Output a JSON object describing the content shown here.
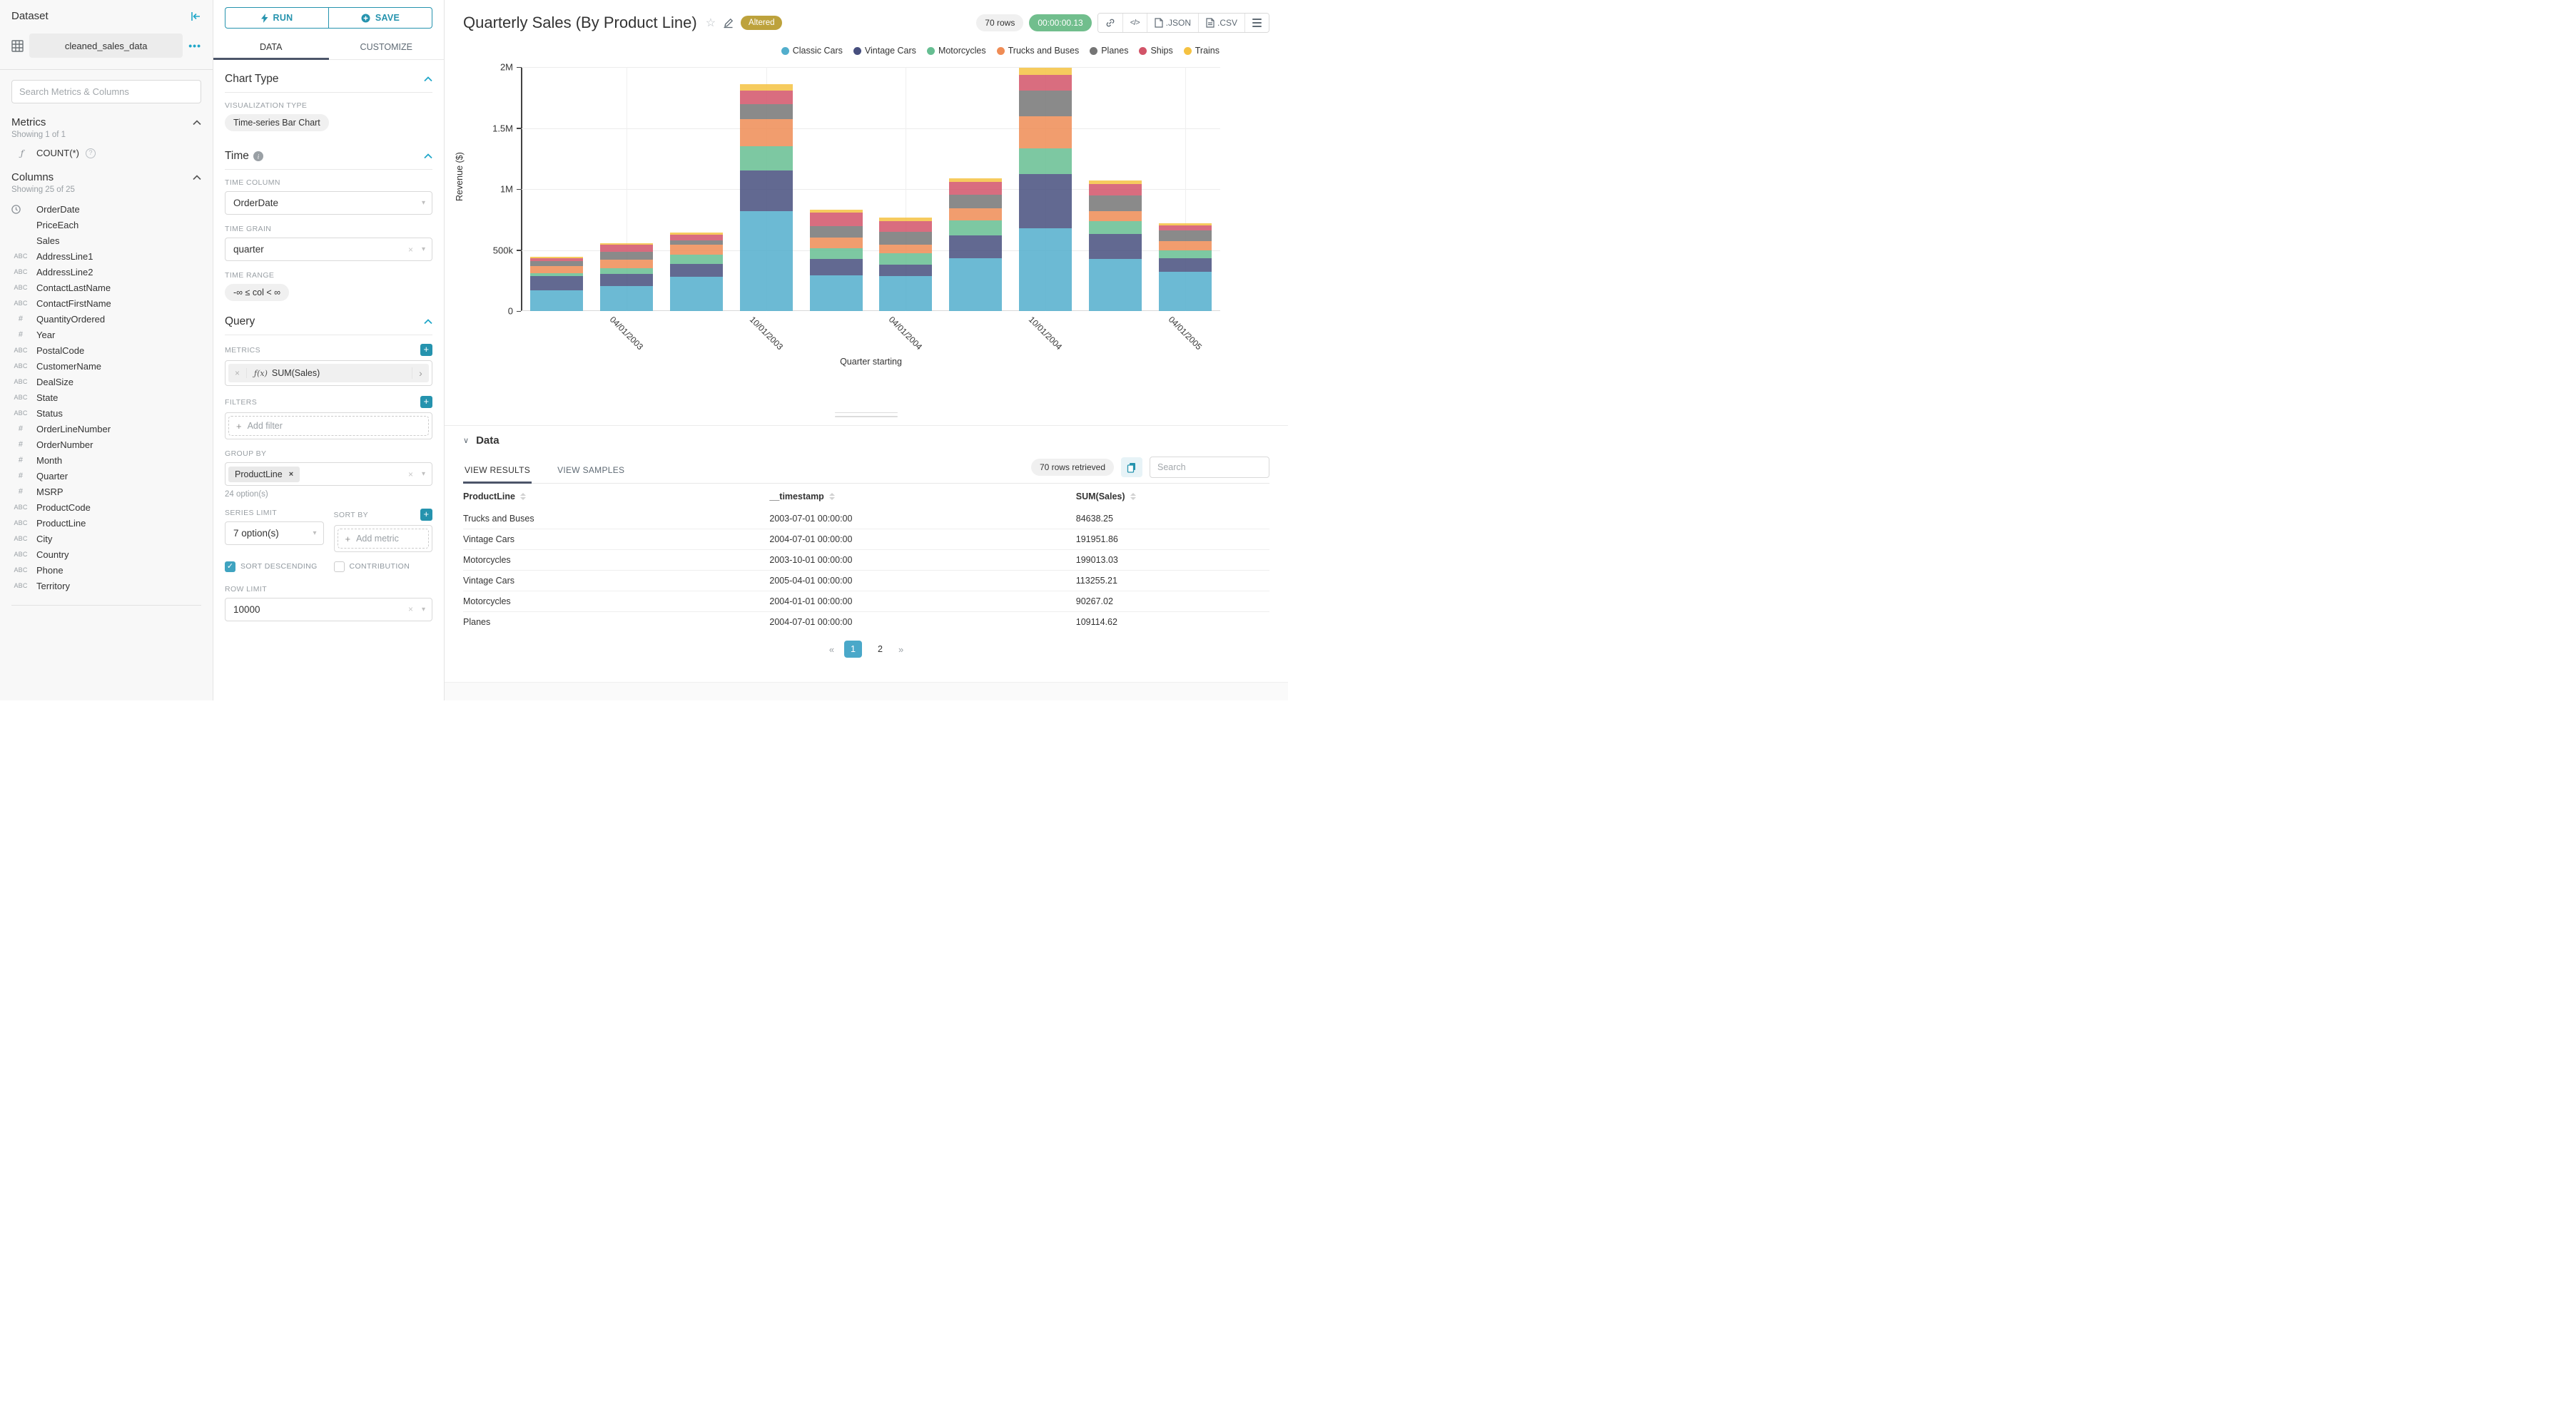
{
  "colors": {
    "accent_teal": "#2593ae",
    "light_teal": "#20a7c9",
    "tab_underline": "#4c5569",
    "altered_badge": "#bda23c",
    "timer_green": "#71be8d",
    "pagination_active": "#4aa8c9"
  },
  "glyphs": {
    "ellipsis": "•••",
    "close": "×",
    "chevron_right": "›",
    "fx": "ƒ(x)",
    "f": "ƒ",
    "plus": "+",
    "prev": "«",
    "next": "»",
    "code": "</>",
    "star": "☆",
    "help": "?",
    "check": "✓",
    "caret": "▾",
    "chev_down": "∨"
  },
  "sidebar": {
    "title": "Dataset",
    "dataset_name": "cleaned_sales_data",
    "search_placeholder": "Search Metrics & Columns",
    "metrics": {
      "title": "Metrics",
      "showing": "Showing 1 of 1",
      "items": [
        {
          "name": "COUNT(*)"
        }
      ]
    },
    "columns": {
      "title": "Columns",
      "showing": "Showing 25 of 25",
      "items": [
        {
          "type": "time",
          "name": "OrderDate"
        },
        {
          "type": "none",
          "name": "PriceEach"
        },
        {
          "type": "none",
          "name": "Sales"
        },
        {
          "type": "text",
          "name": "AddressLine1"
        },
        {
          "type": "text",
          "name": "AddressLine2"
        },
        {
          "type": "text",
          "name": "ContactLastName"
        },
        {
          "type": "text",
          "name": "ContactFirstName"
        },
        {
          "type": "num",
          "name": "QuantityOrdered"
        },
        {
          "type": "num",
          "name": "Year"
        },
        {
          "type": "text",
          "name": "PostalCode"
        },
        {
          "type": "text",
          "name": "CustomerName"
        },
        {
          "type": "text",
          "name": "DealSize"
        },
        {
          "type": "text",
          "name": "State"
        },
        {
          "type": "text",
          "name": "Status"
        },
        {
          "type": "num",
          "name": "OrderLineNumber"
        },
        {
          "type": "num",
          "name": "OrderNumber"
        },
        {
          "type": "num",
          "name": "Month"
        },
        {
          "type": "num",
          "name": "Quarter"
        },
        {
          "type": "num",
          "name": "MSRP"
        },
        {
          "type": "text",
          "name": "ProductCode"
        },
        {
          "type": "text",
          "name": "ProductLine"
        },
        {
          "type": "text",
          "name": "City"
        },
        {
          "type": "text",
          "name": "Country"
        },
        {
          "type": "text",
          "name": "Phone"
        },
        {
          "type": "text",
          "name": "Territory"
        }
      ]
    }
  },
  "panel": {
    "run_label": "RUN",
    "save_label": "SAVE",
    "tabs": {
      "data": "DATA",
      "customize": "CUSTOMIZE"
    },
    "chart_type": {
      "title": "Chart Type",
      "viz_label": "VISUALIZATION TYPE",
      "viz_value": "Time-series Bar Chart"
    },
    "time": {
      "title": "Time",
      "column_label": "TIME COLUMN",
      "column_value": "OrderDate",
      "grain_label": "TIME GRAIN",
      "grain_value": "quarter",
      "range_label": "TIME RANGE",
      "range_value": "-∞ ≤ col < ∞"
    },
    "query": {
      "title": "Query",
      "metrics_label": "METRICS",
      "metric_value": "SUM(Sales)",
      "filters_label": "FILTERS",
      "add_filter": "Add filter",
      "groupby_label": "GROUP BY",
      "groupby_chip": "ProductLine",
      "options_note": "24 option(s)",
      "series_limit_label": "SERIES LIMIT",
      "series_limit_value": "7 option(s)",
      "sort_by_label": "SORT BY",
      "add_metric": "Add metric",
      "sort_descending_label": "SORT DESCENDING",
      "contribution_label": "CONTRIBUTION",
      "row_limit_label": "ROW LIMIT",
      "row_limit_value": "10000"
    }
  },
  "header": {
    "title": "Quarterly Sales (By Product Line)",
    "altered_badge": "Altered",
    "rows_badge": "70 rows",
    "timer_badge": "00:00:00.13",
    "export_json": ".JSON",
    "export_csv": ".CSV"
  },
  "chart_data": {
    "type": "bar",
    "stacked": true,
    "x": [
      "01/01/2003",
      "04/01/2003",
      "07/01/2003",
      "10/01/2003",
      "01/01/2004",
      "04/01/2004",
      "07/01/2004",
      "10/01/2004",
      "01/01/2005",
      "04/01/2005"
    ],
    "x_tick_labels": [
      "",
      "04/01/2003",
      "",
      "10/01/2003",
      "",
      "04/01/2004",
      "",
      "10/01/2004",
      "",
      "04/01/2005"
    ],
    "series": [
      {
        "name": "Classic Cars",
        "color": "#52aecc",
        "values": [
          170000,
          207000,
          281000,
          820000,
          295000,
          285000,
          430000,
          680000,
          425000,
          320000
        ]
      },
      {
        "name": "Vintage Cars",
        "color": "#474f7e",
        "values": [
          114000,
          96500,
          106000,
          330000,
          130000,
          95000,
          191951.86,
          442000,
          205000,
          113255.21
        ]
      },
      {
        "name": "Motorcycles",
        "color": "#66be92",
        "values": [
          29000,
          48000,
          75000,
          199013.03,
          90267.02,
          95000,
          120000,
          213000,
          105000,
          62000
        ]
      },
      {
        "name": "Trucks and Buses",
        "color": "#ef8c55",
        "values": [
          53000,
          72400,
          84638.25,
          225000,
          85000,
          70000,
          100000,
          260000,
          85000,
          80000
        ]
      },
      {
        "name": "Planes",
        "color": "#757575",
        "values": [
          41000,
          62400,
          33000,
          125000,
          95000,
          105000,
          109114.62,
          211000,
          125000,
          85000
        ]
      },
      {
        "name": "Ships",
        "color": "#d25468",
        "values": [
          27000,
          57800,
          48000,
          106000,
          110000,
          90000,
          105000,
          130000,
          95000,
          42000
        ]
      },
      {
        "name": "Trains",
        "color": "#f5c242",
        "values": [
          11500,
          14500,
          17400,
          52000,
          28000,
          26000,
          32000,
          60000,
          32000,
          17000
        ]
      }
    ],
    "ylabel": "Revenue ($)",
    "xlabel": "Quarter starting",
    "ylim": [
      0,
      2000000
    ],
    "y_ticks": [
      {
        "value": 0,
        "label": "0"
      },
      {
        "value": 500000,
        "label": "500k"
      },
      {
        "value": 1000000,
        "label": "1M"
      },
      {
        "value": 1500000,
        "label": "1.5M"
      },
      {
        "value": 2000000,
        "label": "2M"
      }
    ],
    "grid": true,
    "legend_position": "top-right"
  },
  "data_panel": {
    "title": "Data",
    "tab_results": "VIEW RESULTS",
    "tab_samples": "VIEW SAMPLES",
    "rows_retrieved": "70 rows retrieved",
    "search_placeholder": "Search",
    "table": {
      "headers": [
        "ProductLine",
        "__timestamp",
        "SUM(Sales)"
      ],
      "rows": [
        [
          "Trucks and Buses",
          "2003-07-01 00:00:00",
          "84638.25"
        ],
        [
          "Vintage Cars",
          "2004-07-01 00:00:00",
          "191951.86"
        ],
        [
          "Motorcycles",
          "2003-10-01 00:00:00",
          "199013.03"
        ],
        [
          "Vintage Cars",
          "2005-04-01 00:00:00",
          "113255.21"
        ],
        [
          "Motorcycles",
          "2004-01-01 00:00:00",
          "90267.02"
        ],
        [
          "Planes",
          "2004-07-01 00:00:00",
          "109114.62"
        ]
      ]
    },
    "pagination": {
      "prev": "«",
      "pages": [
        "1",
        "2"
      ],
      "active": "1",
      "next": "»"
    }
  }
}
